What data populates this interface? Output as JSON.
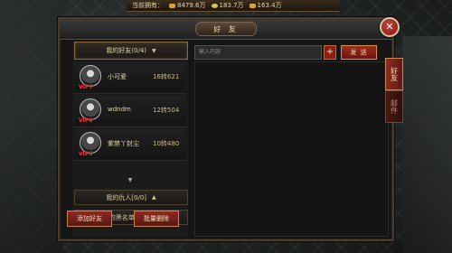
{
  "topbar": {
    "label": "当前拥有：",
    "gold": "8479.6万",
    "ingot": "183.7万",
    "bound_gold": "163.4万"
  },
  "window": {
    "title": "好 友"
  },
  "friends_group": {
    "label": "我的好友(0/4)",
    "members": [
      {
        "name": "小可爱",
        "level": "16转621",
        "vip": "VIP7"
      },
      {
        "name": "wdndm",
        "level": "12转504",
        "vip": "VIP6"
      },
      {
        "name": "紫禁丫封尘",
        "level": "10转480",
        "vip": "VIP6"
      }
    ]
  },
  "enemies_group": {
    "label": "我的仇人[0/0]"
  },
  "blacklist_group": {
    "label": "我的黑名单[0/0]"
  },
  "buttons": {
    "add_friend": "添加好友",
    "batch_delete": "批量删除"
  },
  "chat": {
    "placeholder": "输入内容",
    "send": "发 送"
  },
  "tabs": [
    {
      "label": "好友",
      "active": true
    },
    {
      "label": "邮件",
      "active": false
    }
  ]
}
